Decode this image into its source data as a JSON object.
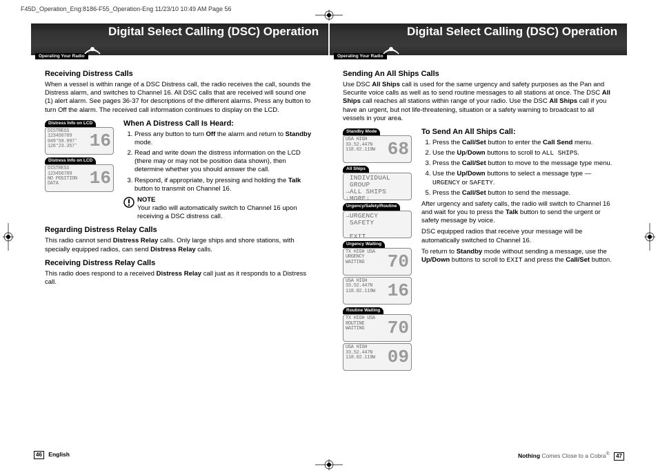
{
  "meta": {
    "header_line": "F45D_Operation_Eng:8186-F55_Operation-Eng  11/23/10  10:49 AM  Page 56"
  },
  "banner": {
    "title": "Digital Select Calling (DSC) Operation",
    "tag": "Operating Your Radio"
  },
  "left": {
    "h_receiving": "Receiving Distress Calls",
    "p_receiving": "When a vessel is within range of a DSC Distress call, the radio receives the call, sounds the Distress alarm, and switches to Channel 16. All DSC calls that are received will sound one (1) alert alarm. See pages 36-37 for descriptions of the different alarms. Press any button to turn Off the alarm. The received call information continues to display on the LCD.",
    "lcd1": {
      "label": "Distress Info on LCD",
      "lines": "DISTRESS\n123456789\n049°59.997'\n126°23.357'",
      "big": "16"
    },
    "lcd2": {
      "label": "Distress Info on LCD",
      "lines": "DISTRESS\n123456789\nNO POSITION\nDATA",
      "big": "16"
    },
    "h_when": "When A Distress Call Is Heard:",
    "steps": {
      "s1a": "Press any button to turn ",
      "s1b": "Off",
      "s1c": " the alarm and return to ",
      "s1d": "Standby",
      "s1e": " mode.",
      "s2": "Read and write down the distress information on the LCD (there may or may not be position data shown), then determine whether you should answer the call.",
      "s3a": "Respond, if appropriate, by pressing and holding the ",
      "s3b": "Talk",
      "s3c": " button to transmit on Channel 16."
    },
    "note_title": "NOTE",
    "note_body": "Your radio will automatically switch to Channel 16 upon receiving a DSC distress call.",
    "h_regarding": "Regarding Distress Relay Calls",
    "p_regarding_a": "This radio cannot send ",
    "p_regarding_b": "Distress Relay",
    "p_regarding_c": " calls. Only large ships and shore stations, with specially equipped radios, can send ",
    "p_regarding_d": "Distress Relay",
    "p_regarding_e": " calls.",
    "h_recv_relay": "Receiving Distress Relay Calls",
    "p_recv_relay_a": "This radio does respond to a received ",
    "p_recv_relay_b": "Distress Relay",
    "p_recv_relay_c": " call juat as it responds to a Distress call."
  },
  "right": {
    "h_sending": "Sending An All Ships Calls",
    "p1a": "Use DSC ",
    "p1b": "All Ships",
    "p1c": " call is used for the same urgency and safety purposes as the Pan and Securite voice calls as well as to send routine messages to all stations at once. The DSC ",
    "p1d": "All Ships",
    "p1e": " call reaches all stations within range of your radio. Use the DSC ",
    "p1f": "All Ships",
    "p1g": " call if you have an urgent, but not life-threatening, situation or a safety warning to broadcast to all vessels in your area.",
    "h_tosend": "To Send An All Ships Call:",
    "s1a": "Press the ",
    "s1b": "Call/Set",
    "s1c": " button to enter the ",
    "s1d": "Call Send",
    "s1e": " menu.",
    "s2a": "Use the ",
    "s2b": "Up",
    "s2c": "/",
    "s2d": "Down",
    "s2e": " buttons to scroll to ",
    "s2f": "ALL SHIPS",
    "s2g": ".",
    "s3a": "Press the ",
    "s3b": "Call/Set",
    "s3c": " button to move to the message type menu.",
    "s4a": "Use the ",
    "s4b": "Up/Down",
    "s4c": " buttons to select a message type — ",
    "s4d": "URGENCY",
    "s4e": " or ",
    "s4f": "SAFETY",
    "s4g": ".",
    "s5a": "Press the ",
    "s5b": "Call/Set",
    "s5c": " button to send the message.",
    "p_after": "After urgency and safety calls, the radio will switch to Channel 16 and wait for you to press the ",
    "p_after_b": "Talk",
    "p_after_c": " button to send the urgent or safety message by voice.",
    "p_dsc": "DSC equipped radios that receive your message will be automatically switched to Channel 16.",
    "p_return_a": "To return to ",
    "p_return_b": "Standby",
    "p_return_c": " mode without sending a message, use the ",
    "p_return_d": "Up/Down",
    "p_return_e": " buttons to scroll to ",
    "p_return_f": "EXIT",
    "p_return_g": " and press the ",
    "p_return_h": "Call/Set",
    "p_return_i": " button.",
    "lcd_standby": {
      "label": "Standby Mode",
      "lines": "USA HIGH\n33.52.447N\n118.02.119W",
      "big": "68"
    },
    "lcd_allships": {
      "label": "All Ships",
      "full": " INDIVIDUAL\n GROUP\n→ALL SHIPS\n↓MORE↓"
    },
    "lcd_urgency": {
      "label": "Urgency/Safety/Routine",
      "full": "→URGENCY\n SAFETY\n\n EXIT"
    },
    "lcd_uwait": {
      "label": "Urgency Waiting"
    },
    "lcd_uwait_a": {
      "lines": "TX HIGH USA\nURGENCY\nWAITING",
      "big": "70"
    },
    "lcd_uwait_b": {
      "lines": "USA HIGH\n33.52.447N\n118.02.119W",
      "big": "16"
    },
    "lcd_rwait": {
      "label": "Routine Waiting"
    },
    "lcd_rwait_a": {
      "lines": "TX HIGH USA\nROUTINE\nWAITING",
      "big": "70"
    },
    "lcd_rwait_b": {
      "lines": "USA HIGH\n33.52.447N\n118.02.119W",
      "big": "09"
    }
  },
  "footer": {
    "pg_left": "46",
    "lang": "English",
    "tagline_a": "Nothing",
    "tagline_b": " Comes Close to a Cobra",
    "reg": "®",
    "pg_right": "47"
  }
}
